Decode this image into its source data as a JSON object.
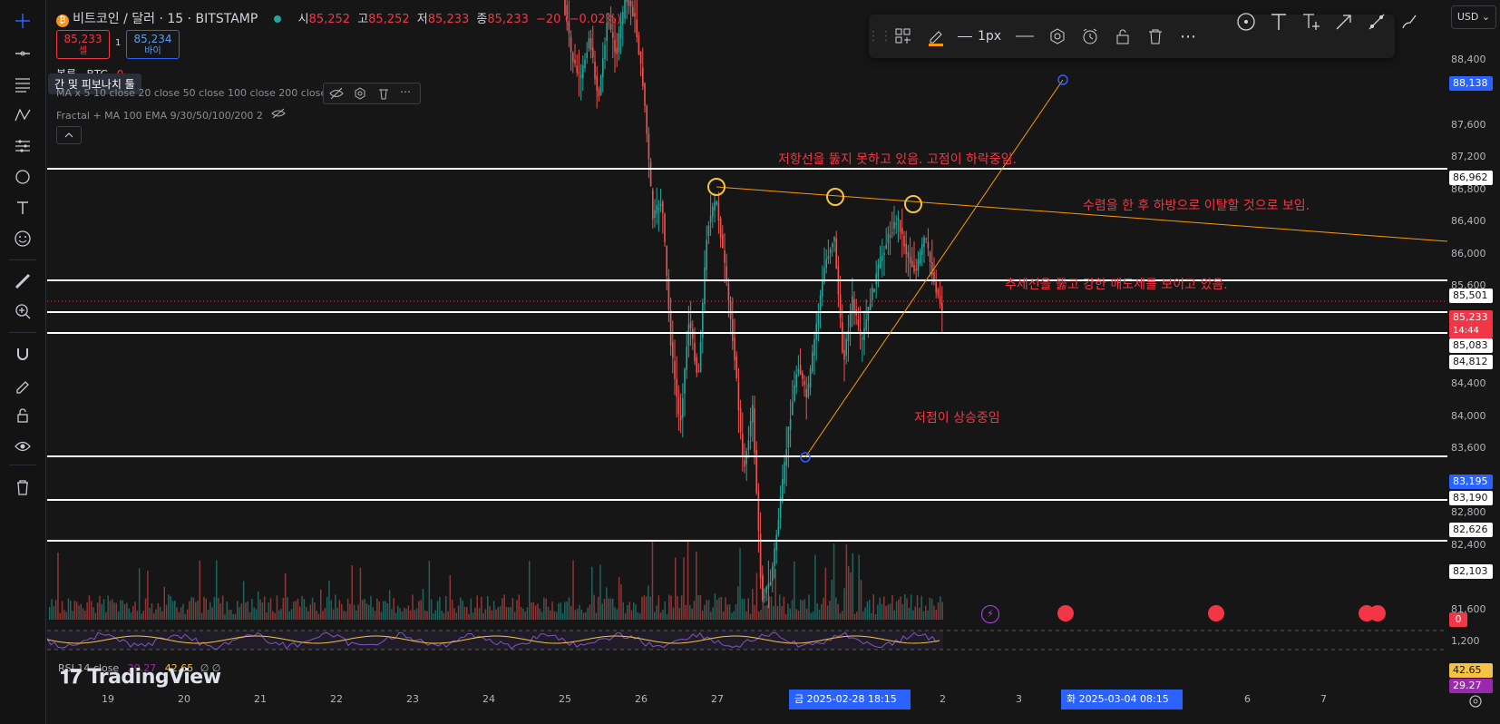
{
  "header": {
    "symbol": "비트코인 / 달러 · 15 · BITSTAMP",
    "o_label": "시",
    "o": "85,252",
    "h_label": "고",
    "h": "85,252",
    "l_label": "저",
    "l": "85,233",
    "c_label": "종",
    "c": "85,233",
    "change": "−20 (−0.02%)",
    "sell_price": "85,233",
    "sell_label": "셀",
    "spread": "1",
    "buy_price": "85,234",
    "buy_label": "바이",
    "volume_label": "볼륨 · BTC",
    "volume_value": "0",
    "tooltip": "간 및 피보나치 툴",
    "ma_line": "MA x 5 10 close 20 close 50 close 100 close 200 close",
    "fractal_line": "Fractal + MA 100 EMA 9/30/50/100/200 2"
  },
  "currency": "USD",
  "toolbar": {
    "width_label": "1px"
  },
  "annotations": {
    "resistance": "저항선을 뚫지 못하고 있음. 고점이 하락중임.",
    "convergence": "수렴을 한 후 하방으로 이탈할 것으로 보임.",
    "breakdown": "추세선을 뚫고 강한 매도세를 보이고 있음.",
    "support": "저점이 상승중임"
  },
  "price_axis": {
    "labels": [
      "88,400",
      "87,600",
      "87,200",
      "86,800",
      "86,400",
      "86,000",
      "85,600",
      "84,400",
      "84,000",
      "83,600",
      "82,800",
      "82,400",
      "81,600",
      "1,200"
    ],
    "tags": {
      "top_blue": "88,138",
      "t1": "86,962",
      "t2": "85,501",
      "current": "85,233",
      "countdown": "14:44",
      "t3": "85,083",
      "t4": "84,812",
      "t5_blue": "83,195",
      "t6": "83,190",
      "t7": "82,626",
      "t8": "82,103",
      "vol": "0",
      "rsi1": "42.65",
      "rsi2": "29.27"
    }
  },
  "rsi": {
    "label": "RSI 14 close",
    "v1": "29.27",
    "v2": "42.65"
  },
  "watermark": "TradingView",
  "time_axis": {
    "labels": [
      "19",
      "20",
      "21",
      "22",
      "23",
      "24",
      "25",
      "26",
      "27",
      "2",
      "3",
      "6",
      "7"
    ],
    "cursor1": "금 2025-02-28   18:15",
    "cursor2": "화 2025-03-04   08:15"
  },
  "colors": {
    "up": "#26a69a",
    "down": "#ef5350",
    "orange": "#ff9800",
    "yellow": "#f5c343",
    "blue": "#2962ff"
  }
}
